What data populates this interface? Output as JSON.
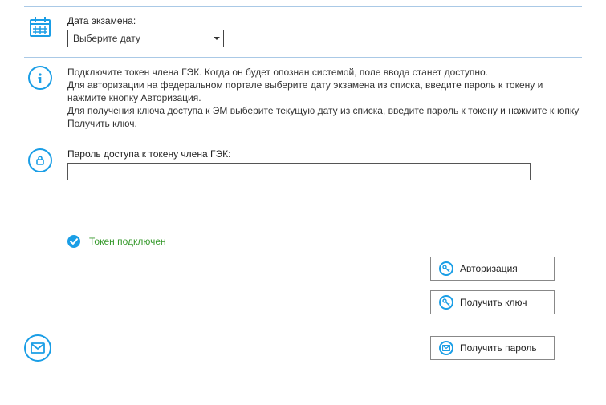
{
  "exam_date": {
    "label": "Дата экзамена:",
    "placeholder": "Выберите дату"
  },
  "info_text": "Подключите токен члена ГЭК. Когда он будет опознан системой, поле ввода станет доступно.\nДля авторизации на федеральном портале выберите дату экзамена из списка, введите пароль к токену и нажмите кнопку Авторизация.\nДля получения ключа доступа к ЭМ выберите текущую дату из списка, введите пароль к токену и нажмите кнопку Получить ключ.",
  "password": {
    "label": "Пароль доступа к токену члена ГЭК:",
    "value": ""
  },
  "status": {
    "text": "Токен подключен"
  },
  "buttons": {
    "auth": "Авторизация",
    "get_key": "Получить ключ",
    "get_password": "Получить пароль"
  },
  "colors": {
    "accent": "#1a9ee6",
    "success": "#389a2e",
    "rule": "#aac9e6"
  },
  "icons": {
    "calendar": "calendar-icon",
    "info": "info-icon",
    "lock": "lock-icon",
    "check": "check-icon",
    "key": "key-icon",
    "envelope": "envelope-icon"
  }
}
